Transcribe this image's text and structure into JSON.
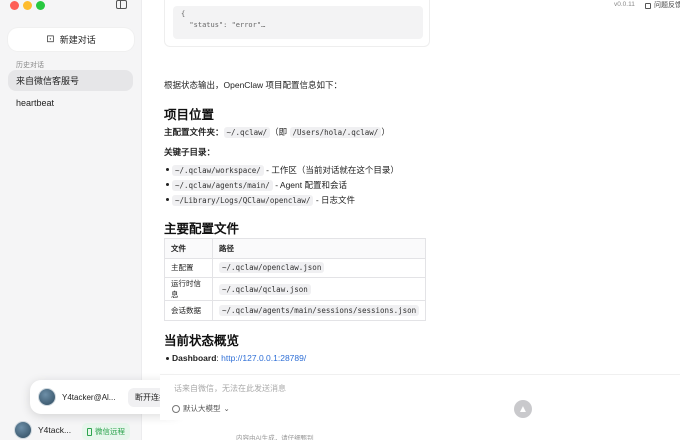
{
  "window": {
    "version": "v0.0.11",
    "feedback": "问题反馈"
  },
  "sidebar": {
    "new_chat": "新建对话",
    "history_label": "历史对话",
    "items": [
      {
        "label": "来自微信客服号"
      },
      {
        "label": "heartbeat"
      }
    ],
    "popup": {
      "name": "Y4tacker@Al...",
      "action": "断开连接"
    },
    "user": {
      "name": "Y4tack...",
      "wechat": "微信远程"
    }
  },
  "main": {
    "code_preview": "{\n  \"status\": \"error\"…",
    "intro": "根据状态输出，OpenClaw 项目配置信息如下：",
    "sec1_title": "项目位置",
    "main_config_label": "主配置文件夹：",
    "main_config_path": "~/.qclaw/",
    "main_config_paren_open": "（即 ",
    "main_config_abs": "/Users/hola/.qclaw/",
    "main_config_paren_close": "）",
    "key_dirs_label": "关键子目录：",
    "dirs": [
      {
        "path": "~/.qclaw/workspace/",
        "desc": " - 工作区（当前对话就在这个目录）"
      },
      {
        "path": "~/.qclaw/agents/main/",
        "desc": " - Agent 配置和会话"
      },
      {
        "path": "~/Library/Logs/QClaw/openclaw/",
        "desc": " - 日志文件"
      }
    ],
    "sec2_title": "主要配置文件",
    "table": {
      "headers": [
        "文件",
        "路径"
      ],
      "rows": [
        [
          "主配置",
          "~/.qclaw/openclaw.json"
        ],
        [
          "运行时信息",
          "~/.qclaw/qclaw.json"
        ],
        [
          "会话数据",
          "~/.qclaw/agents/main/sessions/sessions.json"
        ]
      ]
    },
    "sec3_title": "当前状态概览",
    "dashboard_label": "Dashboard",
    "dashboard_sep": ": ",
    "dashboard_url": "http://127.0.0.1:28789/"
  },
  "composer": {
    "placeholder": "话来自微信，无法在此发送消息",
    "model": "默认大模型"
  },
  "footer": {
    "note": "内容由AI生成，请仔细甄别"
  },
  "icons": {
    "new_chat": "edit-icon",
    "sidebar_toggle": "sidebar-icon",
    "send": "arrow-up-icon"
  }
}
